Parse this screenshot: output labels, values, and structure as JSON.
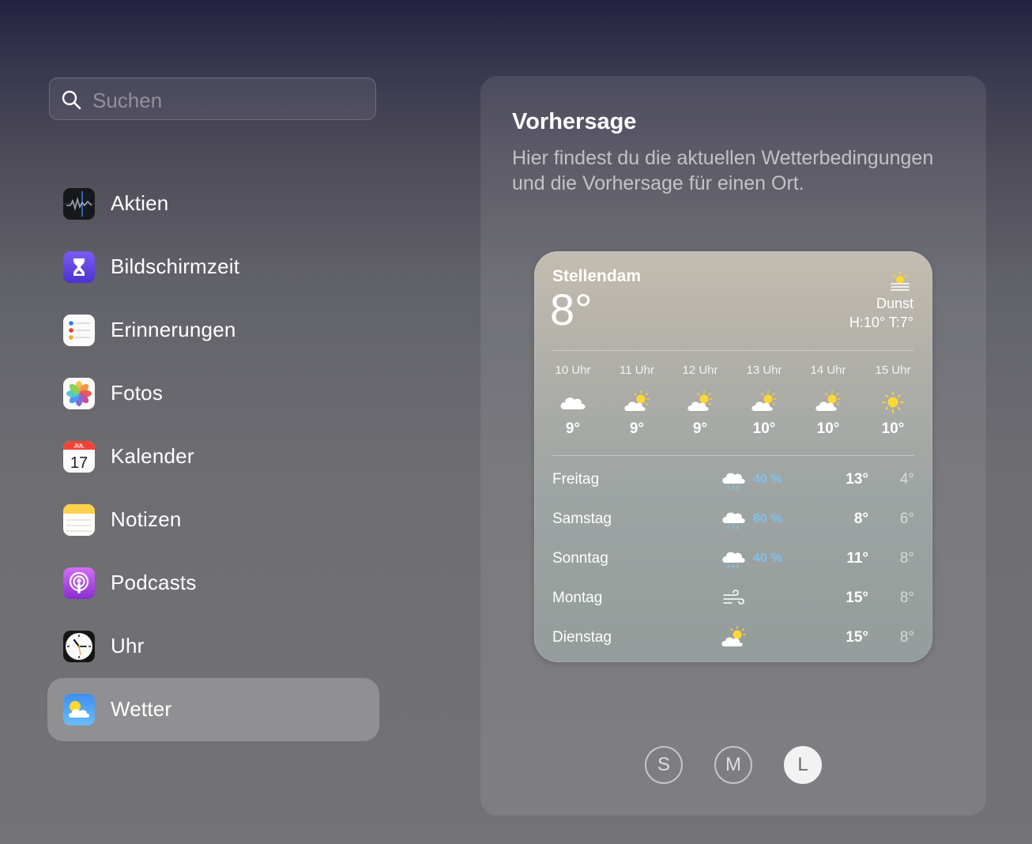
{
  "search": {
    "placeholder": "Suchen",
    "value": ""
  },
  "apps": [
    {
      "label": "Aktien",
      "icon": "stocks-icon"
    },
    {
      "label": "Bildschirmzeit",
      "icon": "screen-time-icon"
    },
    {
      "label": "Erinnerungen",
      "icon": "reminders-icon"
    },
    {
      "label": "Fotos",
      "icon": "photos-icon"
    },
    {
      "label": "Kalender",
      "icon": "calendar-icon",
      "month": "JUL",
      "day": "17"
    },
    {
      "label": "Notizen",
      "icon": "notes-icon"
    },
    {
      "label": "Podcasts",
      "icon": "podcasts-icon"
    },
    {
      "label": "Uhr",
      "icon": "clock-icon"
    },
    {
      "label": "Wetter",
      "icon": "weather-icon",
      "selected": true
    }
  ],
  "panel": {
    "title": "Vorhersage",
    "description": "Hier findest du die aktuellen Wetterbedingungen und die Vorhersage für einen Ort."
  },
  "widget": {
    "city": "Stellendam",
    "temp": "8°",
    "condition": "Dunst",
    "high_low": "H:10° T:7°",
    "condition_icon": "haze-icon",
    "hourly": [
      {
        "time": "10 Uhr",
        "icon": "cloud-icon",
        "temp": "9°"
      },
      {
        "time": "11 Uhr",
        "icon": "partly-sunny-icon",
        "temp": "9°"
      },
      {
        "time": "12 Uhr",
        "icon": "partly-sunny-icon",
        "temp": "9°"
      },
      {
        "time": "13 Uhr",
        "icon": "partly-sunny-icon",
        "temp": "10°"
      },
      {
        "time": "14 Uhr",
        "icon": "partly-sunny-icon",
        "temp": "10°"
      },
      {
        "time": "15 Uhr",
        "icon": "sun-icon",
        "temp": "10°"
      }
    ],
    "daily": [
      {
        "day": "Freitag",
        "icon": "rain-icon",
        "precip": "40 %",
        "high": "13°",
        "low": "4°"
      },
      {
        "day": "Samstag",
        "icon": "rain-icon",
        "precip": "80 %",
        "high": "8°",
        "low": "6°"
      },
      {
        "day": "Sonntag",
        "icon": "rain-icon",
        "precip": "40 %",
        "high": "11°",
        "low": "8°"
      },
      {
        "day": "Montag",
        "icon": "wind-icon",
        "precip": "",
        "high": "15°",
        "low": "8°"
      },
      {
        "day": "Dienstag",
        "icon": "partly-sunny-icon",
        "precip": "",
        "high": "15°",
        "low": "8°"
      }
    ]
  },
  "sizes": [
    {
      "label": "S",
      "active": false
    },
    {
      "label": "M",
      "active": false
    },
    {
      "label": "L",
      "active": true
    }
  ],
  "colors": {
    "precip": "#7fc3ec",
    "selected_bg": "rgba(255,255,255,0.22)"
  }
}
